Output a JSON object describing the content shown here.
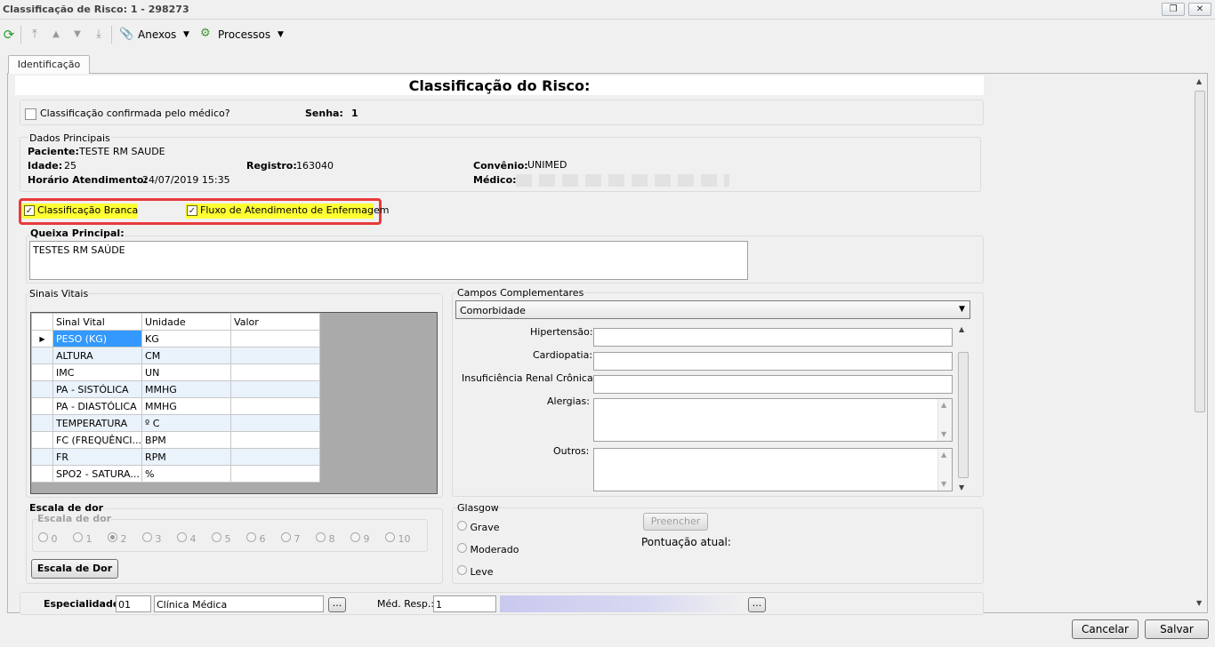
{
  "window": {
    "title": "Classificação de Risco: 1 - 298273"
  },
  "toolbar": {
    "anexos": "Anexos",
    "processos": "Processos"
  },
  "tabs": [
    {
      "label": "Identificação"
    }
  ],
  "header": {
    "title": "Classificação do Risco:"
  },
  "confirmacao": {
    "label": "Classificação confirmada pelo médico?",
    "senha_label": "Senha:",
    "senha_value": "1"
  },
  "dados": {
    "group": "Dados Principais",
    "paciente_label": "Paciente:",
    "paciente": "TESTE RM SAUDE",
    "idade_label": "Idade:",
    "idade": "25",
    "registro_label": "Registro:",
    "registro": "163040",
    "convenio_label": "Convênio:",
    "convenio": "UNIMED",
    "horario_label": "Horário Atendimento:",
    "horario": "24/07/2019 15:35",
    "medico_label": "Médico:"
  },
  "flags": {
    "branca": "Classificação Branca",
    "fluxo": "Fluxo de Atendimento de Enfermagem"
  },
  "queixa": {
    "label": "Queixa Principal:",
    "value": "TESTES RM SAÚDE"
  },
  "sinais": {
    "group": "Sinais Vitais",
    "columns": [
      "Sinal Vital",
      "Unidade",
      "Valor"
    ],
    "rows": [
      {
        "sinal": "PESO (KG)",
        "unidade": "KG",
        "valor": ""
      },
      {
        "sinal": "ALTURA",
        "unidade": "CM",
        "valor": ""
      },
      {
        "sinal": "IMC",
        "unidade": "UN",
        "valor": ""
      },
      {
        "sinal": "PA - SISTÓLICA",
        "unidade": "MMHG",
        "valor": ""
      },
      {
        "sinal": "PA - DIASTÓLICA",
        "unidade": "MMHG",
        "valor": ""
      },
      {
        "sinal": "TEMPERATURA",
        "unidade": "º C",
        "valor": ""
      },
      {
        "sinal": "FC (FREQUÊNCI...",
        "unidade": "BPM",
        "valor": ""
      },
      {
        "sinal": "FR",
        "unidade": "RPM",
        "valor": ""
      },
      {
        "sinal": "SPO2 - SATURA...",
        "unidade": "%",
        "valor": ""
      }
    ]
  },
  "complementares": {
    "group": "Campos Complementares",
    "selected": "Comorbidade",
    "hipertensao": "Hipertensão:",
    "cardiopatia": "Cardiopatia:",
    "insuficiencia": "Insuficiência Renal Crônica:",
    "alergias": "Alergias:",
    "outros": "Outros:"
  },
  "dor": {
    "group": "Escala de dor",
    "subgroup": "Escala de dor",
    "options": [
      "0",
      "1",
      "2",
      "3",
      "4",
      "5",
      "6",
      "7",
      "8",
      "9",
      "10"
    ],
    "selected": "2",
    "button": "Escala de Dor"
  },
  "glasgow": {
    "group": "Glasgow",
    "options": [
      "Grave",
      "Moderado",
      "Leve"
    ],
    "preencher": "Preencher",
    "pontuacao": "Pontuação atual:"
  },
  "especialidade": {
    "label": "Especialidade:",
    "code": "01",
    "name": "Clínica Médica",
    "medresp_label": "Méd. Resp.:",
    "medresp_code": "1",
    "browse": "..."
  },
  "footer": {
    "cancelar": "Cancelar",
    "salvar": "Salvar"
  }
}
